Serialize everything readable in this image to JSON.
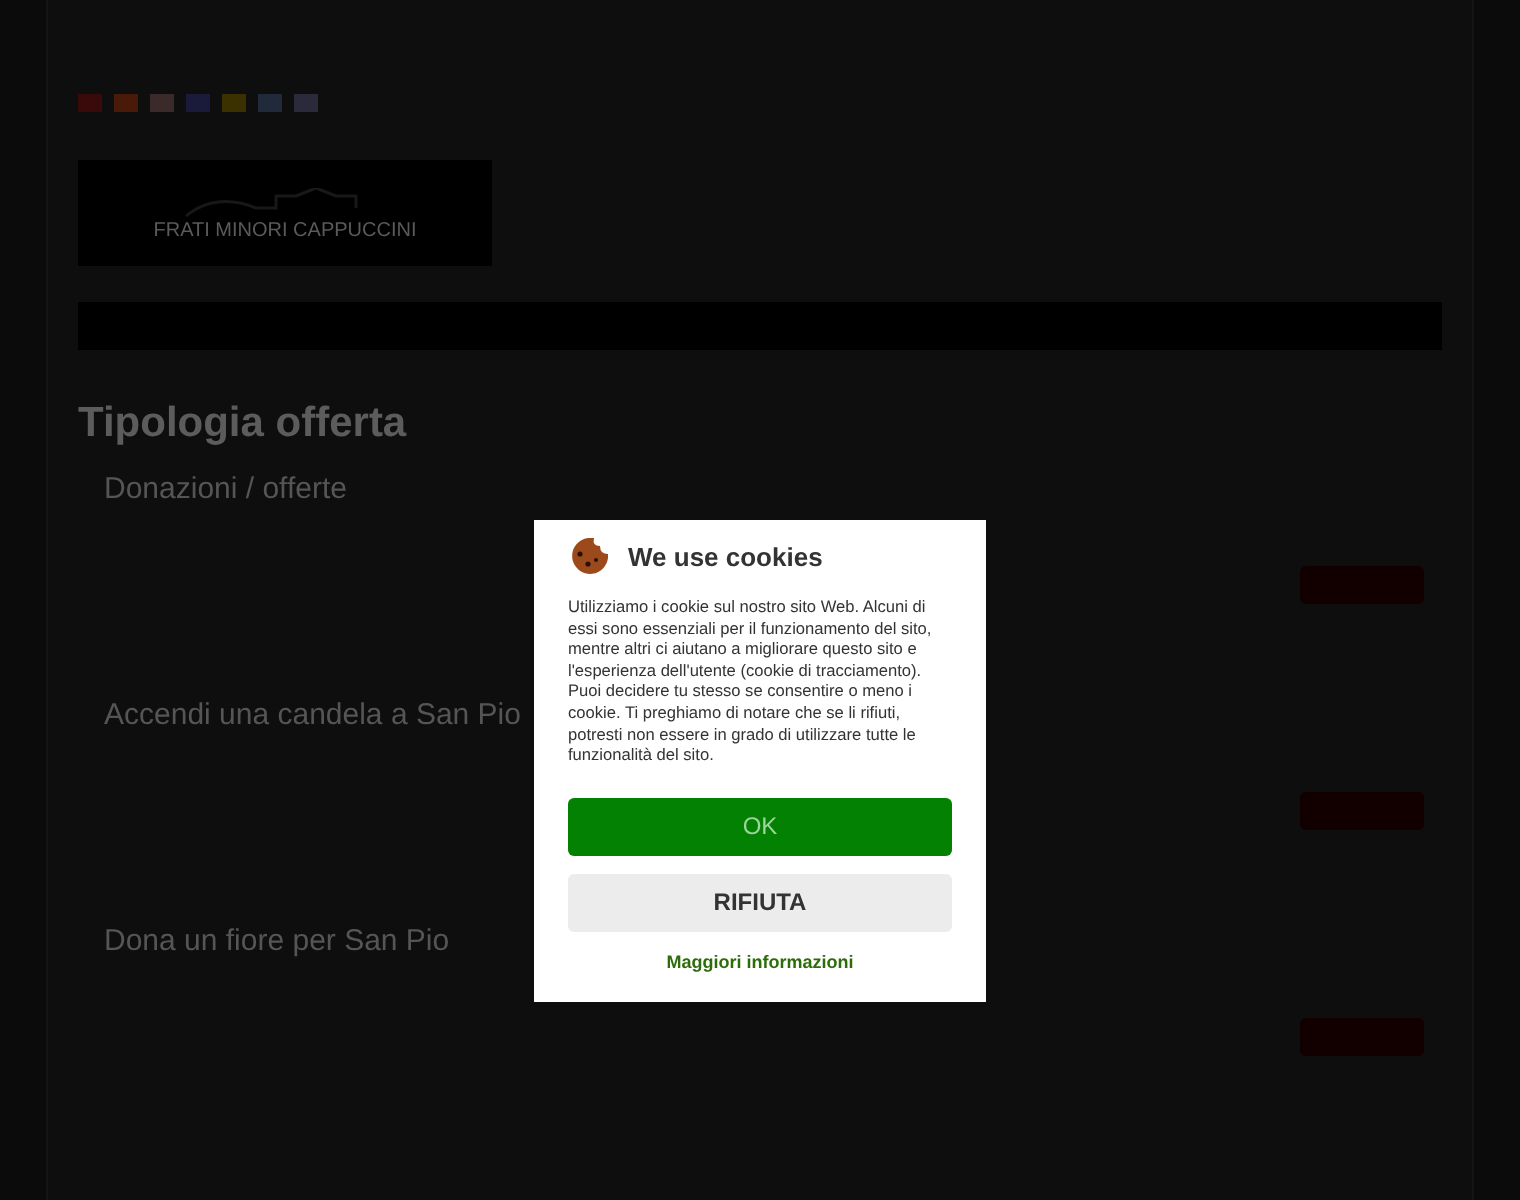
{
  "language_flags": [
    {
      "color": "#3a0a0a"
    },
    {
      "color": "#4a1a08"
    },
    {
      "color": "#3a2a2a"
    },
    {
      "color": "#1a1a3a"
    },
    {
      "color": "#3a3000"
    },
    {
      "color": "#202a3a"
    },
    {
      "color": "#2a2a3a"
    }
  ],
  "logo": {
    "text": "FRATI MINORI CAPPUCCINI"
  },
  "heading": "Tipologia offerta",
  "offers": [
    {
      "title": "Donazioni / offerte"
    },
    {
      "title": "Accendi una candela a San Pio"
    },
    {
      "title": "Dona un fiore per San Pio"
    }
  ],
  "cookie_dialog": {
    "title": "We use cookies",
    "message": "Utilizziamo i cookie sul nostro sito Web. Alcuni di essi sono essenziali per il funzionamento del sito, mentre altri ci aiutano a migliorare questo sito e l'esperienza dell'utente (cookie di tracciamento). Puoi decidere tu stesso se consentire o meno i cookie. Ti preghiamo di notare che se li rifiuti, potresti non essere in grado di utilizzare tutte le funzionalità del sito.",
    "buttons": [
      {
        "kind": "accept",
        "label": "OK"
      },
      {
        "kind": "reject",
        "label": "RIFIUTA"
      }
    ],
    "link": "Maggiori informazioni"
  }
}
